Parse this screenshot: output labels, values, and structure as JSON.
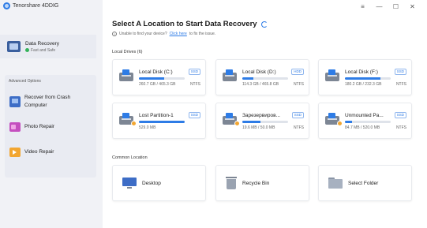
{
  "app": {
    "title": "Tenorshare 4DDIG"
  },
  "window_controls": {
    "menu": "≡",
    "minimize": "—",
    "maximize": "☐",
    "close": "✕"
  },
  "sidebar": {
    "primary": {
      "label": "Data Recovery",
      "sub": "Fast and Safe"
    },
    "advanced_title": "Advanced Options",
    "advanced_items": [
      {
        "label": "Recover from Crash Computer",
        "icon": "crashed-computer-icon"
      },
      {
        "label": "Photo Repair",
        "icon": "photo-icon"
      },
      {
        "label": "Video Repair",
        "icon": "video-icon"
      }
    ]
  },
  "main": {
    "headline": "Select A Location to Start Data Recovery",
    "help": {
      "prefix": "Unable to find your device?",
      "link": "Click here",
      "suffix": "to fix the issue."
    },
    "local_drives_label": "Local Drives (6)",
    "drives": [
      {
        "name": "Local Disk (C:)",
        "type": "SSD",
        "size": "260.7 GB / 465.3 GB",
        "fs": "NTFS",
        "used_fraction": 0.56
      },
      {
        "name": "Local Disk (D:)",
        "type": "HDD",
        "size": "114.3 GB / 465.8 GB",
        "fs": "NTFS",
        "used_fraction": 0.245
      },
      {
        "name": "Local Disk (F:)",
        "type": "SSD",
        "size": "180.2 GB / 232.3 GB",
        "fs": "NTFS",
        "used_fraction": 0.775
      },
      {
        "name": "Lost Partition-1",
        "type": "SSD",
        "size": "529.0 MB",
        "fs": "",
        "used_fraction": 1.0
      },
      {
        "name": "Зарезервиров...",
        "type": "SSD",
        "size": "19.6 MB / 50.0 MB",
        "fs": "NTFS",
        "used_fraction": 0.39
      },
      {
        "name": "Unmounted Pa...",
        "type": "SSD",
        "size": "84.7 MB / 520.0 MB",
        "fs": "NTFS",
        "used_fraction": 0.16
      }
    ],
    "common_location_label": "Common Location",
    "locations": [
      {
        "label": "Desktop",
        "icon": "desktop-icon"
      },
      {
        "label": "Recycle Bin",
        "icon": "recycle-bin-icon"
      },
      {
        "label": "Select Folder",
        "icon": "folder-icon"
      }
    ]
  }
}
